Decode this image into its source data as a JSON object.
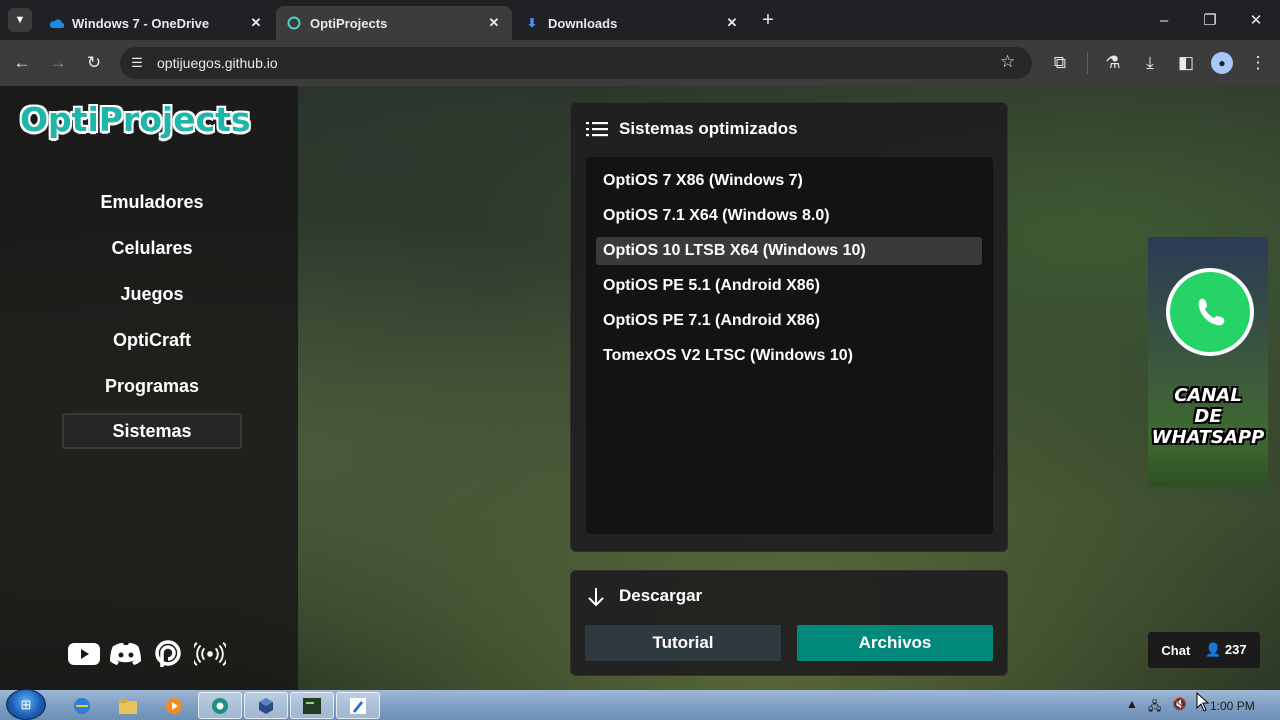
{
  "browser": {
    "tabs": [
      {
        "title": "Windows 7 - OneDrive",
        "favicon": "onedrive-icon",
        "active": false
      },
      {
        "title": "OptiProjects",
        "favicon": "optiprojects-icon",
        "active": true
      },
      {
        "title": "Downloads",
        "favicon": "download-icon",
        "active": false
      }
    ],
    "url": "optijuegos.github.io"
  },
  "site": {
    "logo": "OptiProjects",
    "nav": [
      "Emuladores",
      "Celulares",
      "Juegos",
      "OptiCraft",
      "Programas",
      "Sistemas"
    ],
    "nav_active": "Sistemas",
    "socials": [
      "youtube-icon",
      "discord-icon",
      "patreon-icon",
      "broadcast-icon"
    ]
  },
  "systems_panel": {
    "title": "Sistemas optimizados",
    "items": [
      "OptiOS 7 X86 (Windows 7)",
      "OptiOS 7.1 X64 (Windows 8.0)",
      "OptiOS 10 LTSB X64 (Windows 10)",
      "OptiOS PE 5.1 (Android X86)",
      "OptiOS PE 7.1 (Android X86)",
      "TomexOS V2 LTSC (Windows 10)"
    ],
    "selected": "OptiOS 10 LTSB X64 (Windows 10)"
  },
  "download_panel": {
    "title": "Descargar",
    "tutorial_label": "Tutorial",
    "files_label": "Archivos"
  },
  "whatsapp_banner": {
    "line1": "CANAL",
    "line2": "DE",
    "line3": "WHATSAPP"
  },
  "chat": {
    "label": "Chat",
    "count": "237"
  },
  "taskbar": {
    "time": "1:00 PM"
  },
  "colors": {
    "accent": "#00897b",
    "logo": "#1fb5a8",
    "whatsapp": "#25d366"
  }
}
